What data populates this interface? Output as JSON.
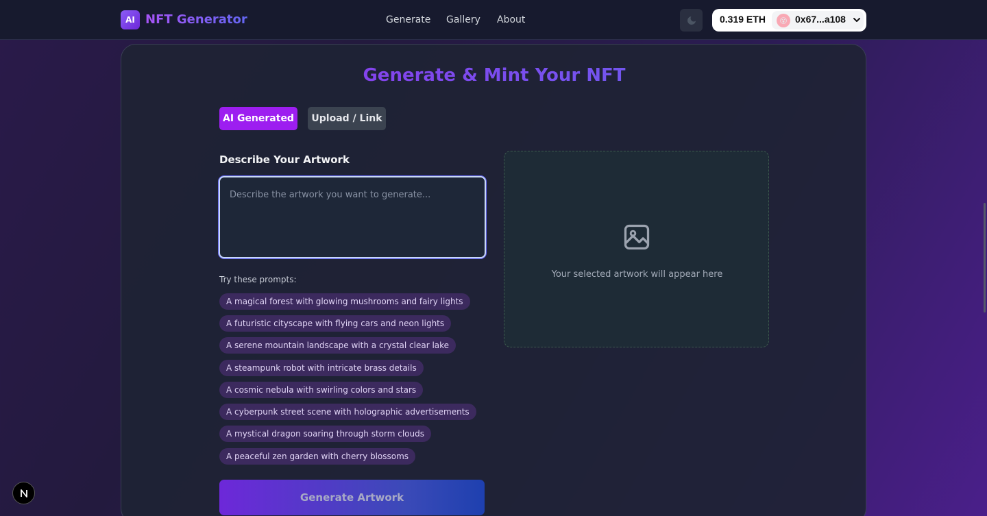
{
  "header": {
    "logo_badge": "AI",
    "logo_text": "NFT Generator",
    "nav": [
      "Generate",
      "Gallery",
      "About"
    ],
    "wallet": {
      "balance": "0.319 ETH",
      "avatar_emoji": "😵",
      "address": "0x67...a108"
    }
  },
  "main": {
    "title": "Generate & Mint Your NFT",
    "tabs": [
      {
        "label": "AI Generated",
        "active": true
      },
      {
        "label": "Upload / Link",
        "active": false
      }
    ],
    "describe_label": "Describe Your Artwork",
    "prompt_placeholder": "Describe the artwork you want to generate...",
    "try_label": "Try these prompts:",
    "prompts": [
      "A magical forest with glowing mushrooms and fairy lights",
      "A futuristic cityscape with flying cars and neon lights",
      "A serene mountain landscape with a crystal clear lake",
      "A steampunk robot with intricate brass details",
      "A cosmic nebula with swirling colors and stars",
      "A cyberpunk street scene with holographic advertisements",
      "A mystical dragon soaring through storm clouds",
      "A peaceful zen garden with cherry blossoms"
    ],
    "generate_button": "Generate Artwork",
    "preview_text": "Your selected artwork will appear here"
  },
  "icons": {
    "theme": "moon-icon",
    "preview": "image-icon",
    "dropdown": "chevron-down-icon",
    "next_badge": "N"
  },
  "colors": {
    "accent_purple": "#9d1ef0",
    "header_bg": "#171a2e",
    "card_bg": "#1e2334"
  }
}
